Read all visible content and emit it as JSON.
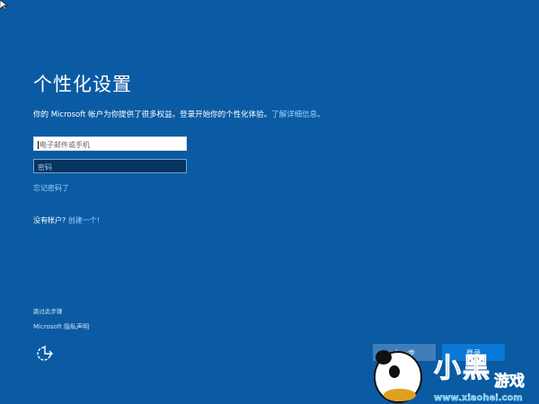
{
  "page": {
    "title": "个性化设置",
    "description": "你的 Microsoft 帐户为你提供了很多权益。登录开始你的个性化体验。",
    "learn_more": "了解详细信息。",
    "email_placeholder": "电子邮件或手机",
    "password_placeholder": "密码",
    "forgot_password": "忘记密码了",
    "no_account": "没有帐户?",
    "create_one": "创建一个!",
    "skip": "跳过此步骤",
    "privacy": "Microsoft 隐私声明",
    "back_button": "上一步",
    "signin_button": "登录"
  },
  "watermark": {
    "brand": "小黑游戏",
    "url": "www.xiaohei.com"
  },
  "colors": {
    "background": "#0a5ba3",
    "link": "#9fd1ff",
    "primary_button": "#0a78d7"
  }
}
